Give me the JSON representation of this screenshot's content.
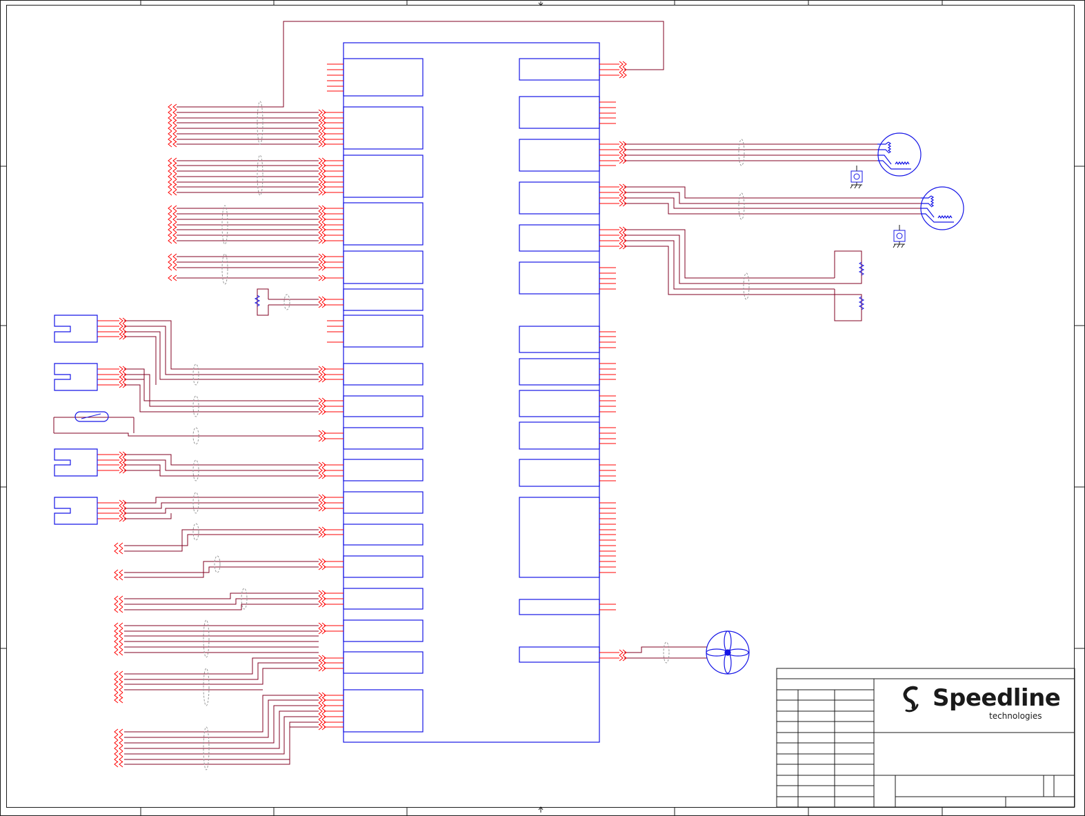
{
  "title_block": {
    "company": "Speedline",
    "company_sub": "technologies"
  },
  "colors": {
    "frame": "#1a1a1a",
    "component": "#1414e6",
    "wire": "#800020",
    "pin": "#ff0000",
    "shield": "#999999"
  },
  "components": {
    "motor_count": 2,
    "sensor_count": 4,
    "heater_count": 2,
    "fan_count": 1
  }
}
